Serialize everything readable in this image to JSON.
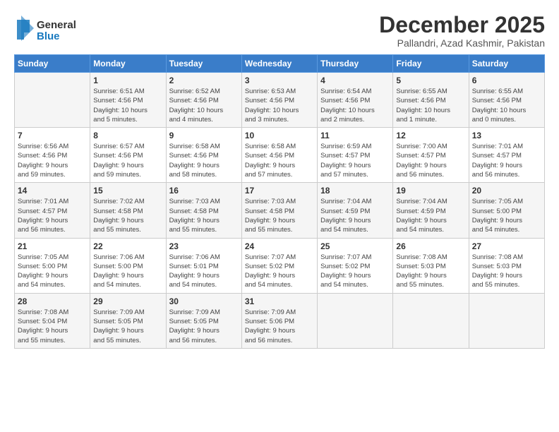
{
  "header": {
    "logo_line1": "General",
    "logo_line2": "Blue",
    "month": "December 2025",
    "location": "Pallandri, Azad Kashmir, Pakistan"
  },
  "days_of_week": [
    "Sunday",
    "Monday",
    "Tuesday",
    "Wednesday",
    "Thursday",
    "Friday",
    "Saturday"
  ],
  "weeks": [
    [
      {
        "day": "",
        "info": ""
      },
      {
        "day": "1",
        "info": "Sunrise: 6:51 AM\nSunset: 4:56 PM\nDaylight: 10 hours\nand 5 minutes."
      },
      {
        "day": "2",
        "info": "Sunrise: 6:52 AM\nSunset: 4:56 PM\nDaylight: 10 hours\nand 4 minutes."
      },
      {
        "day": "3",
        "info": "Sunrise: 6:53 AM\nSunset: 4:56 PM\nDaylight: 10 hours\nand 3 minutes."
      },
      {
        "day": "4",
        "info": "Sunrise: 6:54 AM\nSunset: 4:56 PM\nDaylight: 10 hours\nand 2 minutes."
      },
      {
        "day": "5",
        "info": "Sunrise: 6:55 AM\nSunset: 4:56 PM\nDaylight: 10 hours\nand 1 minute."
      },
      {
        "day": "6",
        "info": "Sunrise: 6:55 AM\nSunset: 4:56 PM\nDaylight: 10 hours\nand 0 minutes."
      }
    ],
    [
      {
        "day": "7",
        "info": "Sunrise: 6:56 AM\nSunset: 4:56 PM\nDaylight: 9 hours\nand 59 minutes."
      },
      {
        "day": "8",
        "info": "Sunrise: 6:57 AM\nSunset: 4:56 PM\nDaylight: 9 hours\nand 59 minutes."
      },
      {
        "day": "9",
        "info": "Sunrise: 6:58 AM\nSunset: 4:56 PM\nDaylight: 9 hours\nand 58 minutes."
      },
      {
        "day": "10",
        "info": "Sunrise: 6:58 AM\nSunset: 4:56 PM\nDaylight: 9 hours\nand 57 minutes."
      },
      {
        "day": "11",
        "info": "Sunrise: 6:59 AM\nSunset: 4:57 PM\nDaylight: 9 hours\nand 57 minutes."
      },
      {
        "day": "12",
        "info": "Sunrise: 7:00 AM\nSunset: 4:57 PM\nDaylight: 9 hours\nand 56 minutes."
      },
      {
        "day": "13",
        "info": "Sunrise: 7:01 AM\nSunset: 4:57 PM\nDaylight: 9 hours\nand 56 minutes."
      }
    ],
    [
      {
        "day": "14",
        "info": "Sunrise: 7:01 AM\nSunset: 4:57 PM\nDaylight: 9 hours\nand 56 minutes."
      },
      {
        "day": "15",
        "info": "Sunrise: 7:02 AM\nSunset: 4:58 PM\nDaylight: 9 hours\nand 55 minutes."
      },
      {
        "day": "16",
        "info": "Sunrise: 7:03 AM\nSunset: 4:58 PM\nDaylight: 9 hours\nand 55 minutes."
      },
      {
        "day": "17",
        "info": "Sunrise: 7:03 AM\nSunset: 4:58 PM\nDaylight: 9 hours\nand 55 minutes."
      },
      {
        "day": "18",
        "info": "Sunrise: 7:04 AM\nSunset: 4:59 PM\nDaylight: 9 hours\nand 54 minutes."
      },
      {
        "day": "19",
        "info": "Sunrise: 7:04 AM\nSunset: 4:59 PM\nDaylight: 9 hours\nand 54 minutes."
      },
      {
        "day": "20",
        "info": "Sunrise: 7:05 AM\nSunset: 5:00 PM\nDaylight: 9 hours\nand 54 minutes."
      }
    ],
    [
      {
        "day": "21",
        "info": "Sunrise: 7:05 AM\nSunset: 5:00 PM\nDaylight: 9 hours\nand 54 minutes."
      },
      {
        "day": "22",
        "info": "Sunrise: 7:06 AM\nSunset: 5:00 PM\nDaylight: 9 hours\nand 54 minutes."
      },
      {
        "day": "23",
        "info": "Sunrise: 7:06 AM\nSunset: 5:01 PM\nDaylight: 9 hours\nand 54 minutes."
      },
      {
        "day": "24",
        "info": "Sunrise: 7:07 AM\nSunset: 5:02 PM\nDaylight: 9 hours\nand 54 minutes."
      },
      {
        "day": "25",
        "info": "Sunrise: 7:07 AM\nSunset: 5:02 PM\nDaylight: 9 hours\nand 54 minutes."
      },
      {
        "day": "26",
        "info": "Sunrise: 7:08 AM\nSunset: 5:03 PM\nDaylight: 9 hours\nand 55 minutes."
      },
      {
        "day": "27",
        "info": "Sunrise: 7:08 AM\nSunset: 5:03 PM\nDaylight: 9 hours\nand 55 minutes."
      }
    ],
    [
      {
        "day": "28",
        "info": "Sunrise: 7:08 AM\nSunset: 5:04 PM\nDaylight: 9 hours\nand 55 minutes."
      },
      {
        "day": "29",
        "info": "Sunrise: 7:09 AM\nSunset: 5:05 PM\nDaylight: 9 hours\nand 55 minutes."
      },
      {
        "day": "30",
        "info": "Sunrise: 7:09 AM\nSunset: 5:05 PM\nDaylight: 9 hours\nand 56 minutes."
      },
      {
        "day": "31",
        "info": "Sunrise: 7:09 AM\nSunset: 5:06 PM\nDaylight: 9 hours\nand 56 minutes."
      },
      {
        "day": "",
        "info": ""
      },
      {
        "day": "",
        "info": ""
      },
      {
        "day": "",
        "info": ""
      }
    ]
  ]
}
